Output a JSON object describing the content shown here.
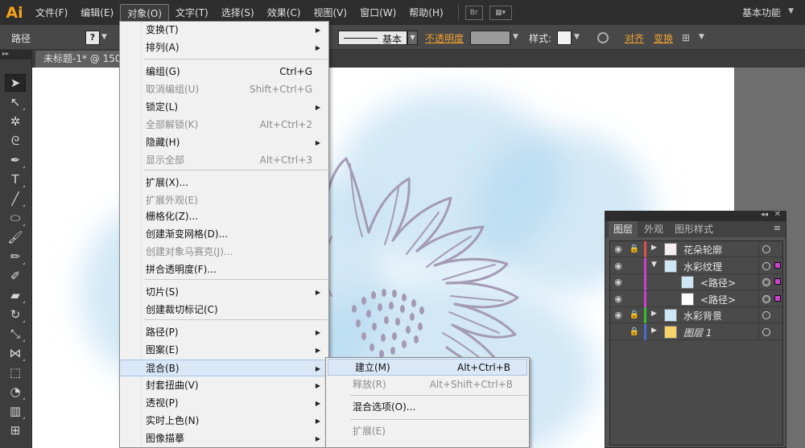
{
  "app": {
    "logo": "Ai",
    "workspace": "基本功能"
  },
  "menubar": {
    "items": [
      "文件(F)",
      "编辑(E)",
      "对象(O)",
      "文字(T)",
      "选择(S)",
      "效果(C)",
      "视图(V)",
      "窗口(W)",
      "帮助(H)"
    ],
    "active": "对象(O)",
    "bridge_label": "Br"
  },
  "controlbar": {
    "selection_label": "路径",
    "stroke_profile": "基本",
    "opacity_label": "不透明度",
    "style_label": "样式:",
    "align_label": "对齐",
    "transform_label": "变换"
  },
  "document_tab": {
    "title": "未标题-1* @ 150%"
  },
  "object_menu": {
    "items": [
      {
        "label": "变换(T)",
        "submenu": true
      },
      {
        "label": "排列(A)",
        "submenu": true
      },
      {
        "label": "编组(G)",
        "shortcut": "Ctrl+G"
      },
      {
        "label": "取消编组(U)",
        "shortcut": "Shift+Ctrl+G",
        "disabled": true
      },
      {
        "label": "锁定(L)",
        "submenu": true
      },
      {
        "label": "全部解锁(K)",
        "shortcut": "Alt+Ctrl+2",
        "disabled": true
      },
      {
        "label": "隐藏(H)",
        "submenu": true
      },
      {
        "label": "显示全部",
        "shortcut": "Alt+Ctrl+3",
        "disabled": true
      },
      {
        "label": "扩展(X)..."
      },
      {
        "label": "扩展外观(E)",
        "disabled": true
      },
      {
        "label": "栅格化(Z)..."
      },
      {
        "label": "创建渐变网格(D)..."
      },
      {
        "label": "创建对象马赛克(J)...",
        "disabled": true
      },
      {
        "label": "拼合透明度(F)..."
      },
      {
        "label": "切片(S)",
        "submenu": true
      },
      {
        "label": "创建裁切标记(C)"
      },
      {
        "label": "路径(P)",
        "submenu": true
      },
      {
        "label": "图案(E)",
        "submenu": true
      },
      {
        "label": "混合(B)",
        "submenu": true,
        "highlighted": true
      },
      {
        "label": "封套扭曲(V)",
        "submenu": true
      },
      {
        "label": "透视(P)",
        "submenu": true
      },
      {
        "label": "实时上色(N)",
        "submenu": true
      },
      {
        "label": "图像描摹",
        "submenu": true
      }
    ]
  },
  "blend_submenu": {
    "items": [
      {
        "label": "建立(M)",
        "shortcut": "Alt+Ctrl+B",
        "highlighted": true
      },
      {
        "label": "释放(R)",
        "shortcut": "Alt+Shift+Ctrl+B",
        "disabled": true
      },
      {
        "label": "混合选项(O)..."
      },
      {
        "label": "扩展(E)",
        "disabled": true
      }
    ]
  },
  "layers_panel": {
    "tabs": [
      "图层",
      "外观",
      "图形样式"
    ],
    "active_tab": "图层",
    "rows": [
      {
        "name": "花朵轮廓",
        "color": "#e05050",
        "locked": true,
        "expanded": false,
        "indent": 0,
        "thumb": "flower",
        "italic": false,
        "selected": false
      },
      {
        "name": "水彩纹理",
        "color": "#d040d0",
        "locked": false,
        "expanded": true,
        "indent": 0,
        "thumb": "blue",
        "italic": false,
        "selected": true
      },
      {
        "name": "<路径>",
        "color": "#d040d0",
        "locked": false,
        "expanded": null,
        "indent": 1,
        "thumb": "blue",
        "italic": false,
        "selected": true
      },
      {
        "name": "<路径>",
        "color": "#d040d0",
        "locked": false,
        "expanded": null,
        "indent": 1,
        "thumb": "white",
        "italic": false,
        "selected": true
      },
      {
        "name": "水彩背景",
        "color": "#30c030",
        "locked": true,
        "expanded": false,
        "indent": 0,
        "thumb": "blue",
        "italic": false,
        "selected": false
      },
      {
        "name": "图层 1",
        "color": "#4a6ad0",
        "locked": true,
        "expanded": false,
        "indent": 0,
        "thumb": "yellow",
        "italic": true,
        "selected": false
      }
    ]
  }
}
